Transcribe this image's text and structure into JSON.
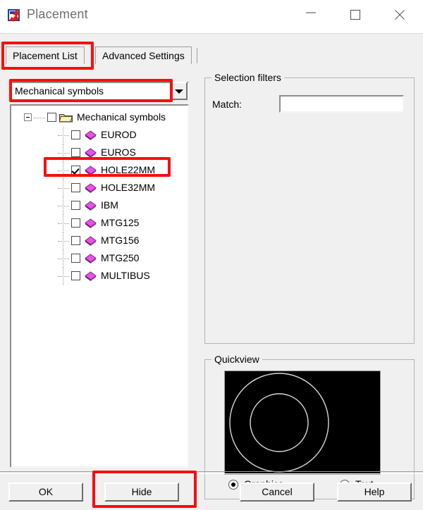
{
  "window": {
    "title": "Placement",
    "icon": "placement-app-icon",
    "controls": {
      "minimize": "minimize-icon",
      "maximize": "maximize-icon",
      "close": "close-icon"
    }
  },
  "tabs": [
    {
      "label": "Placement List",
      "selected": true
    },
    {
      "label": "Advanced Settings",
      "selected": false
    }
  ],
  "combo": {
    "value": "Mechanical symbols",
    "arrow": "chevron-down-icon"
  },
  "tree": {
    "root": {
      "label": "Mechanical symbols",
      "checked": false,
      "expanded": true,
      "icon": "open-folder-icon"
    },
    "items": [
      {
        "label": "EUROD",
        "checked": false,
        "icon": "diamond-symbol-icon"
      },
      {
        "label": "EUROS",
        "checked": false,
        "icon": "diamond-symbol-icon"
      },
      {
        "label": "HOLE22MM",
        "checked": true,
        "icon": "diamond-symbol-icon"
      },
      {
        "label": "HOLE32MM",
        "checked": false,
        "icon": "diamond-symbol-icon"
      },
      {
        "label": "IBM",
        "checked": false,
        "icon": "diamond-symbol-icon"
      },
      {
        "label": "MTG125",
        "checked": false,
        "icon": "diamond-symbol-icon"
      },
      {
        "label": "MTG156",
        "checked": false,
        "icon": "diamond-symbol-icon"
      },
      {
        "label": "MTG250",
        "checked": false,
        "icon": "diamond-symbol-icon"
      },
      {
        "label": "MULTIBUS",
        "checked": false,
        "icon": "diamond-symbol-icon"
      }
    ]
  },
  "selection_filters": {
    "caption": "Selection filters",
    "match_label": "Match:",
    "match_value": "",
    "match_placeholder": ""
  },
  "quickview": {
    "caption": "Quickview",
    "preview": "two-concentric-circles",
    "background": "#000000",
    "stroke": "#d7d7d7",
    "mode_options": [
      {
        "label": "Graphics",
        "selected": true
      },
      {
        "label": "Text",
        "selected": false
      }
    ]
  },
  "buttons": [
    {
      "id": "ok",
      "label": "OK"
    },
    {
      "id": "hide",
      "label": "Hide"
    },
    {
      "id": "cancel",
      "label": "Cancel"
    },
    {
      "id": "help",
      "label": "Help"
    }
  ],
  "annotations": {
    "color": "#fb0d0d",
    "highlights": [
      "placement-list-tab",
      "category-combo",
      "hole22mm-row",
      "hide-button"
    ]
  }
}
